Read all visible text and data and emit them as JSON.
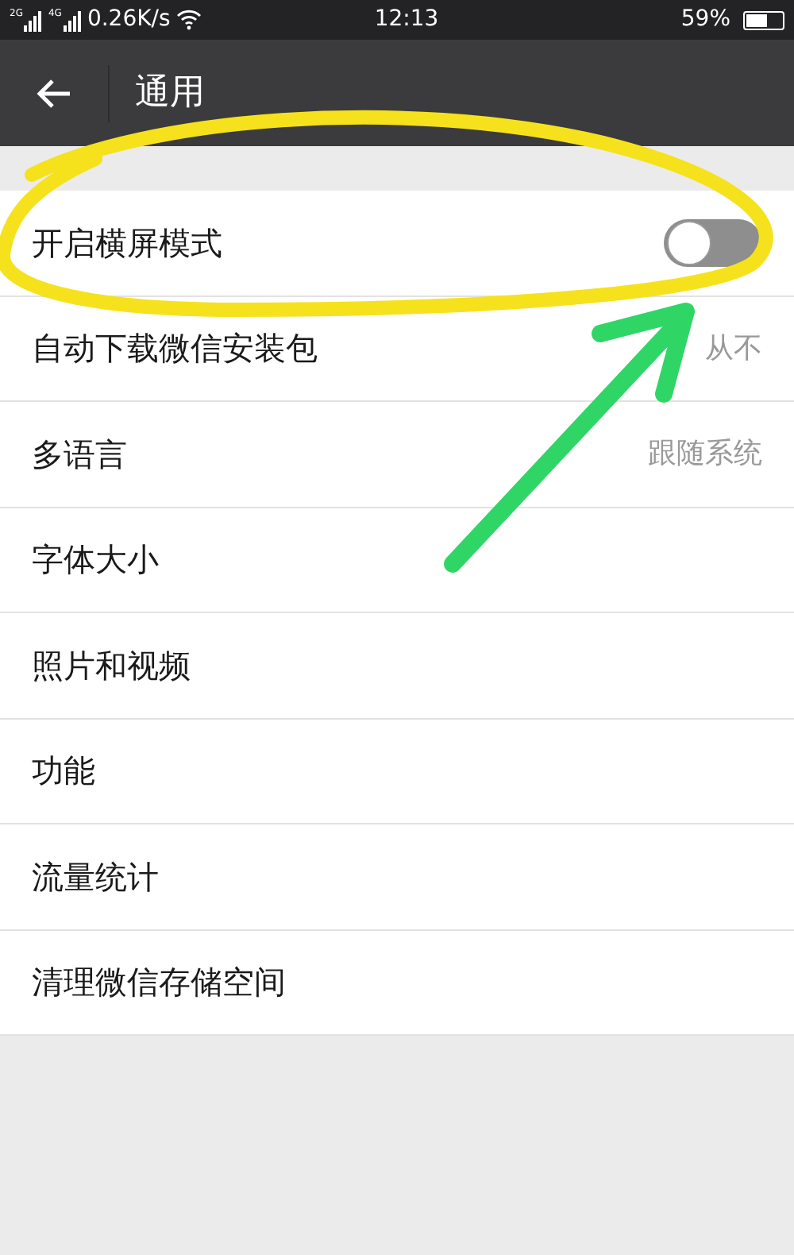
{
  "status_bar": {
    "signals": [
      "2G",
      "4G"
    ],
    "speed": "0.26K/s",
    "time": "12:13",
    "battery": "59%"
  },
  "header": {
    "title": "通用"
  },
  "items": [
    {
      "kind": "toggle",
      "label": "开启横屏模式",
      "on": false
    },
    {
      "kind": "value",
      "label": "自动下载微信安装包",
      "value": "从不"
    },
    {
      "kind": "value",
      "label": "多语言",
      "value": "跟随系统"
    },
    {
      "kind": "plain",
      "label": "字体大小"
    },
    {
      "kind": "plain",
      "label": "照片和视频"
    },
    {
      "kind": "plain",
      "label": "功能"
    },
    {
      "kind": "plain",
      "label": "流量统计"
    },
    {
      "kind": "plain",
      "label": "清理微信存储空间"
    }
  ]
}
